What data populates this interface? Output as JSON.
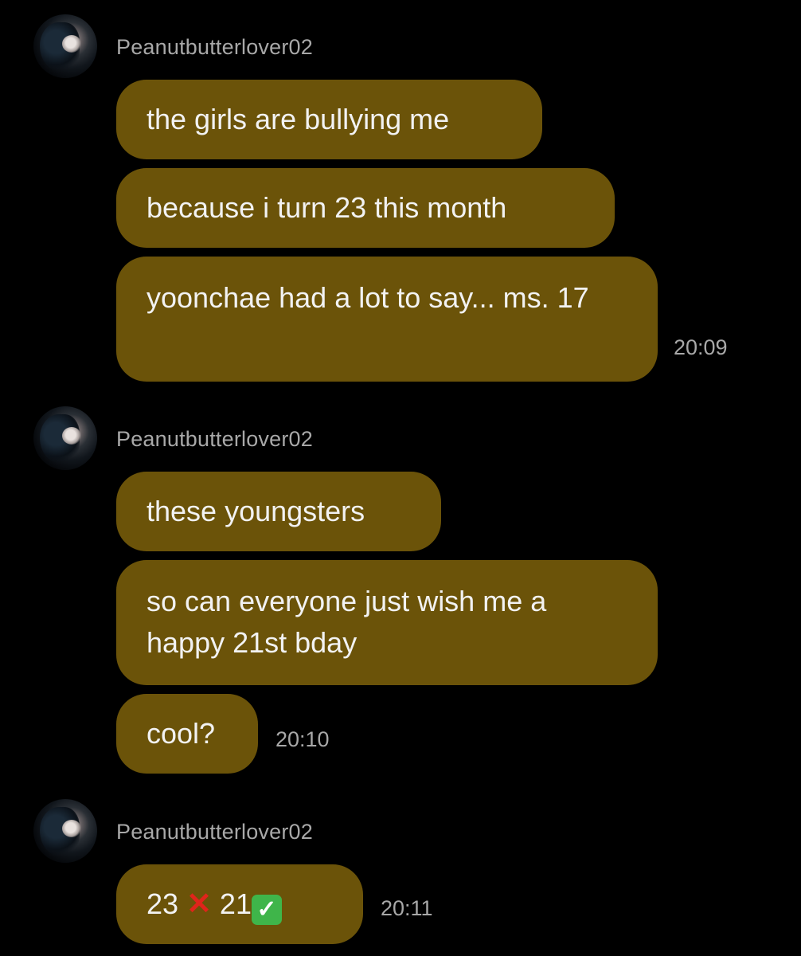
{
  "groups": [
    {
      "username": "Peanutbutterlover02",
      "messages": [
        "the girls are bullying me",
        "because i turn 23 this month",
        "yoonchae had a lot to say... ms. 17"
      ],
      "time": "20:09"
    },
    {
      "username": "Peanutbutterlover02",
      "messages": [
        "these youngsters",
        "so can everyone just wish me a happy 21st bday",
        "cool?"
      ],
      "time": "20:10"
    },
    {
      "username": "Peanutbutterlover02",
      "last_message": {
        "part1": "23",
        "cross": "✕",
        "part2": "21",
        "check": "✓"
      },
      "time": "20:11"
    }
  ],
  "icons": {
    "cross": "cross-mark-icon",
    "check": "check-mark-button-icon"
  },
  "colors": {
    "background": "#000000",
    "bubble": "#6b5309",
    "meta_text": "#a8a8a8"
  }
}
